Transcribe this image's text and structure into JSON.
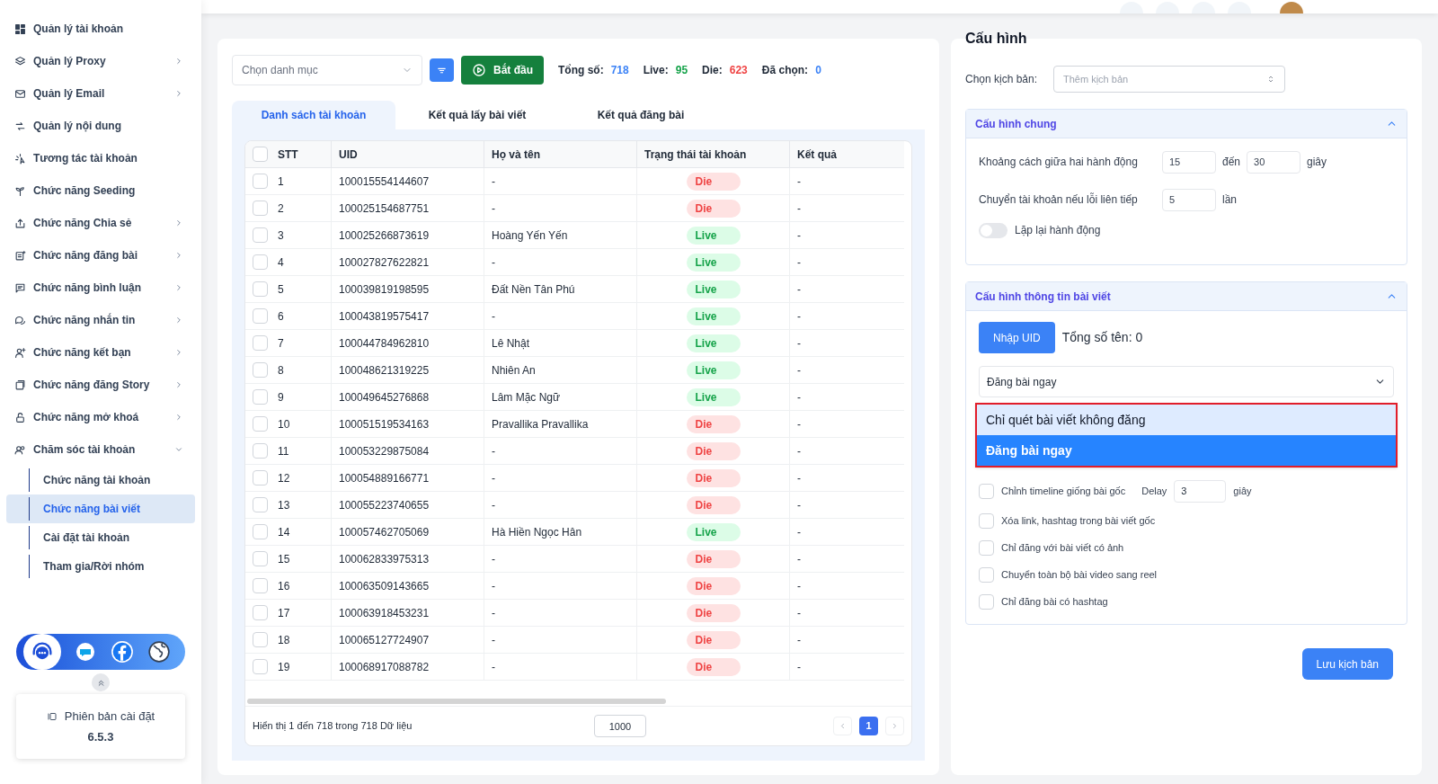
{
  "sidebar": {
    "items": [
      {
        "label": "Quản lý tài khoản",
        "kind": "link"
      },
      {
        "label": "Quản lý Proxy",
        "kind": "menu",
        "expanded": false
      },
      {
        "label": "Quản lý Email",
        "kind": "menu",
        "expanded": false
      },
      {
        "label": "Quản lý nội dung",
        "kind": "link"
      },
      {
        "label": "Tương tác tài khoản",
        "kind": "link"
      },
      {
        "label": "Chức năng Seeding",
        "kind": "link"
      },
      {
        "label": "Chức năng Chia sẻ",
        "kind": "menu",
        "expanded": false
      },
      {
        "label": "Chức năng đăng bài",
        "kind": "menu",
        "expanded": false
      },
      {
        "label": "Chức năng bình luận",
        "kind": "menu",
        "expanded": false
      },
      {
        "label": "Chức năng nhắn tin",
        "kind": "menu",
        "expanded": false
      },
      {
        "label": "Chức năng kết bạn",
        "kind": "menu",
        "expanded": false
      },
      {
        "label": "Chức năng đăng Story",
        "kind": "menu",
        "expanded": false
      },
      {
        "label": "Chức năng mở khoá",
        "kind": "menu",
        "expanded": false
      },
      {
        "label": "Chăm sóc tài khoản",
        "kind": "menu",
        "expanded": true,
        "children": [
          {
            "label": "Chức năng tài khoản",
            "selected": false
          },
          {
            "label": "Chức năng bài viết",
            "selected": true
          },
          {
            "label": "Cài đặt tài khoản",
            "selected": false
          },
          {
            "label": "Tham gia/Rời nhóm",
            "selected": false
          }
        ]
      }
    ],
    "version": {
      "label": "Phiên bản cài đặt",
      "number": "6.5.3"
    }
  },
  "toolbar": {
    "category_placeholder": "Chọn danh mục",
    "start_button": "Bắt đầu",
    "stats": [
      {
        "label": "Tổng số:",
        "value": "718",
        "color": "#3b82f6"
      },
      {
        "label": "Live:",
        "value": "95",
        "color": "#16a34a"
      },
      {
        "label": "Die:",
        "value": "623",
        "color": "#ef4444"
      },
      {
        "label": "Đã chọn:",
        "value": "0",
        "color": "#3b82f6"
      }
    ]
  },
  "tabs": [
    {
      "label": "Danh sách tài khoản",
      "selected": true
    },
    {
      "label": "Kết quả lấy bài viết",
      "selected": false
    },
    {
      "label": "Kết quả đăng bài",
      "selected": false
    }
  ],
  "table": {
    "header_checked": false,
    "columns": [
      "STT",
      "UID",
      "Họ và tên",
      "Trạng thái tài khoản",
      "Kết quả"
    ],
    "rows": [
      {
        "stt": "1",
        "uid": "100015554144607",
        "name": "-",
        "status": "Die",
        "alive": false,
        "result": "-",
        "checked": false
      },
      {
        "stt": "2",
        "uid": "100025154687751",
        "name": "-",
        "status": "Die",
        "alive": false,
        "result": "-",
        "checked": false
      },
      {
        "stt": "3",
        "uid": "100025266873619",
        "name": "Hoàng Yến Yến",
        "status": "Live",
        "alive": true,
        "result": "-",
        "checked": false
      },
      {
        "stt": "4",
        "uid": "100027827622821",
        "name": "-",
        "status": "Live",
        "alive": true,
        "result": "-",
        "checked": false
      },
      {
        "stt": "5",
        "uid": "100039819198595",
        "name": "Đất Nền Tân Phú",
        "status": "Live",
        "alive": true,
        "result": "-",
        "checked": false
      },
      {
        "stt": "6",
        "uid": "100043819575417",
        "name": "-",
        "status": "Live",
        "alive": true,
        "result": "-",
        "checked": false
      },
      {
        "stt": "7",
        "uid": "100044784962810",
        "name": "Lê Nhật",
        "status": "Live",
        "alive": true,
        "result": "-",
        "checked": false
      },
      {
        "stt": "8",
        "uid": "100048621319225",
        "name": "Nhiên An",
        "status": "Live",
        "alive": true,
        "result": "-",
        "checked": false
      },
      {
        "stt": "9",
        "uid": "100049645276868",
        "name": "Lâm Mặc Ngữ",
        "status": "Live",
        "alive": true,
        "result": "-",
        "checked": false
      },
      {
        "stt": "10",
        "uid": "100051519534163",
        "name": "Pravallika Pravallika",
        "status": "Die",
        "alive": false,
        "result": "-",
        "checked": false
      },
      {
        "stt": "11",
        "uid": "100053229875084",
        "name": "-",
        "status": "Die",
        "alive": false,
        "result": "-",
        "checked": false
      },
      {
        "stt": "12",
        "uid": "100054889166771",
        "name": "-",
        "status": "Die",
        "alive": false,
        "result": "-",
        "checked": false
      },
      {
        "stt": "13",
        "uid": "100055223740655",
        "name": "-",
        "status": "Die",
        "alive": false,
        "result": "-",
        "checked": false
      },
      {
        "stt": "14",
        "uid": "100057462705069",
        "name": "Hà Hiền Ngọc Hân",
        "status": "Live",
        "alive": true,
        "result": "-",
        "checked": false
      },
      {
        "stt": "15",
        "uid": "100062833975313",
        "name": "-",
        "status": "Die",
        "alive": false,
        "result": "-",
        "checked": false
      },
      {
        "stt": "16",
        "uid": "100063509143665",
        "name": "-",
        "status": "Die",
        "alive": false,
        "result": "-",
        "checked": false
      },
      {
        "stt": "17",
        "uid": "100063918453231",
        "name": "-",
        "status": "Die",
        "alive": false,
        "result": "-",
        "checked": false
      },
      {
        "stt": "18",
        "uid": "100065127724907",
        "name": "-",
        "status": "Die",
        "alive": false,
        "result": "-",
        "checked": false
      },
      {
        "stt": "19",
        "uid": "100068917088782",
        "name": "-",
        "status": "Die",
        "alive": false,
        "result": "-",
        "checked": false
      }
    ],
    "footer_text": "Hiển thị 1 đến 718 trong 718 Dữ liệu",
    "page_size": "1000",
    "pages": [
      {
        "label": "1",
        "selected": true
      }
    ]
  },
  "config": {
    "title": "Cấu hình",
    "script_label": "Chọn kịch bản:",
    "script_placeholder": "Thêm kịch bản",
    "general": {
      "title": "Cấu hình chung",
      "expanded": true,
      "interval": {
        "label": "Khoảng cách giữa hai hành động",
        "from": "15",
        "to_label": "đến",
        "to": "30",
        "unit": "giây"
      },
      "switch_account": {
        "label": "Chuyển tài khoản nếu lỗi liên tiếp",
        "value": "5",
        "unit": "lần"
      },
      "repeat": {
        "label": "Lặp lại hành động",
        "on": false
      }
    },
    "post": {
      "title": "Cấu hình thông tin bài viết",
      "expanded": true,
      "uid_button": "Nhập UID",
      "total_names": "Tổng số tên: 0",
      "mode_value": "Đăng bài ngay",
      "mode_options": [
        {
          "label": "Chỉ quét bài viết không đăng",
          "selected": false,
          "hovered": true
        },
        {
          "label": "Đăng bài ngay",
          "selected": true,
          "hovered": false
        }
      ],
      "options": [
        {
          "label": "Chỉnh timeline giống bài gốc",
          "checked": false,
          "delay": {
            "label": "Delay",
            "value": "3",
            "unit": "giây"
          }
        },
        {
          "label": "Xóa link, hashtag trong bài viết gốc",
          "checked": false
        },
        {
          "label": "Chỉ đăng với bài viết có ảnh",
          "checked": false
        },
        {
          "label": "Chuyển toàn bộ bài video sang reel",
          "checked": false
        },
        {
          "label": "Chỉ đăng bài có hashtag",
          "checked": false
        }
      ]
    },
    "save_button": "Lưu kịch bản"
  }
}
